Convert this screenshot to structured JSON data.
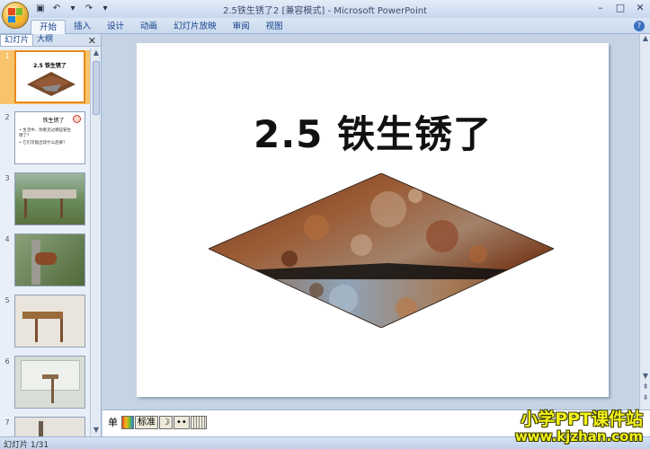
{
  "window": {
    "title": "2.5铁生锈了2 [兼容模式] - Microsoft PowerPoint"
  },
  "ribbon": {
    "tabs": [
      {
        "label": "开始",
        "active": true
      },
      {
        "label": "插入"
      },
      {
        "label": "设计"
      },
      {
        "label": "动画"
      },
      {
        "label": "幻灯片放映"
      },
      {
        "label": "审阅"
      },
      {
        "label": "视图"
      }
    ]
  },
  "panel": {
    "tabs": [
      {
        "label": "幻灯片"
      },
      {
        "label": "大纲"
      }
    ],
    "close_symbol": "✕"
  },
  "thumbnails": [
    {
      "number": "1",
      "title": "2.5 铁生锈了",
      "selected": true
    },
    {
      "number": "2",
      "title": "铁生锈了",
      "lines": [
        "• 生活中，你看见过哪些铁生锈了？",
        "• 它们可能出现什么后果？"
      ]
    },
    {
      "number": "3"
    },
    {
      "number": "4"
    },
    {
      "number": "5"
    },
    {
      "number": "6"
    },
    {
      "number": "7"
    }
  ],
  "slide": {
    "title": "2.5 铁生锈了"
  },
  "notes": {
    "ime_label": "单",
    "ime_mode": "标准",
    "ime_moon": "☽",
    "ime_dots": "••"
  },
  "status": {
    "slide_indicator": "幻灯片 1/31"
  },
  "watermark": {
    "line1": "小学PPT课件站",
    "line2": "www.kjzhan.com"
  },
  "colors": {
    "ribbon_blue": "#15428b",
    "selection_orange": "#f9c36b",
    "watermark_yellow": "#f2f21c"
  }
}
